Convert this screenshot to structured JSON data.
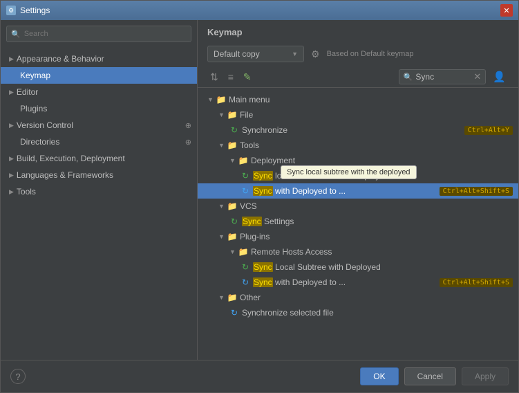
{
  "window": {
    "title": "Settings",
    "icon": "⚙"
  },
  "sidebar": {
    "search_placeholder": "Search",
    "items": [
      {
        "label": "Appearance & Behavior",
        "type": "parent",
        "expanded": true
      },
      {
        "label": "Keymap",
        "type": "child",
        "active": true
      },
      {
        "label": "Editor",
        "type": "parent",
        "expanded": true
      },
      {
        "label": "Plugins",
        "type": "child"
      },
      {
        "label": "Version Control",
        "type": "parent",
        "expanded": true
      },
      {
        "label": "Directories",
        "type": "child"
      },
      {
        "label": "Build, Execution, Deployment",
        "type": "parent"
      },
      {
        "label": "Languages & Frameworks",
        "type": "parent"
      },
      {
        "label": "Tools",
        "type": "parent"
      }
    ]
  },
  "keymap": {
    "title": "Keymap",
    "dropdown_value": "Default copy",
    "based_on": "Based on Default keymap",
    "search_placeholder": "Sync",
    "search_value": "Sync",
    "toolbar": {
      "btn1": "⇅",
      "btn2": "≡",
      "btn3": "✎"
    },
    "tree": [
      {
        "id": "main-menu",
        "level": 0,
        "type": "folder",
        "expanded": true,
        "label": "Main menu",
        "color": "blue"
      },
      {
        "id": "file",
        "level": 1,
        "type": "folder",
        "expanded": true,
        "label": "File",
        "color": "yellow"
      },
      {
        "id": "synchronize",
        "level": 2,
        "type": "action",
        "label": "Synchronize",
        "shortcut": "Ctrl+Alt+Y",
        "highlight": false,
        "sync_highlight": false
      },
      {
        "id": "tools",
        "level": 1,
        "type": "folder",
        "expanded": true,
        "label": "Tools",
        "color": "blue"
      },
      {
        "id": "deployment",
        "level": 2,
        "type": "folder",
        "expanded": true,
        "label": "Deployment",
        "color": "yellow"
      },
      {
        "id": "sync-local",
        "level": 3,
        "type": "action",
        "label": "Sync local subtree with the deployed",
        "tooltip": "Sync local subtree with the deployed",
        "has_tooltip": true
      },
      {
        "id": "sync-deployed",
        "level": 3,
        "type": "action",
        "label": "Sync with Deployed to ...",
        "shortcut": "Ctrl+Alt+Shift+S",
        "selected": true,
        "sync_prefix": "Sync"
      },
      {
        "id": "vcs",
        "level": 1,
        "type": "folder",
        "expanded": true,
        "label": "VCS",
        "color": "blue"
      },
      {
        "id": "sync-settings",
        "level": 2,
        "type": "action",
        "label": "Sync Settings",
        "sync_prefix": "Sync"
      },
      {
        "id": "plugins",
        "level": 1,
        "type": "folder",
        "expanded": true,
        "label": "Plug-ins",
        "color": "blue"
      },
      {
        "id": "remote-hosts",
        "level": 2,
        "type": "folder",
        "expanded": true,
        "label": "Remote Hosts Access",
        "color": "yellow"
      },
      {
        "id": "sync-local-2",
        "level": 3,
        "type": "action",
        "label": "Sync Local Subtree with Deployed",
        "sync_prefix": "Sync"
      },
      {
        "id": "sync-deployed-2",
        "level": 3,
        "type": "action",
        "label": "Sync with Deployed to ...",
        "shortcut": "Ctrl+Alt+Shift+S",
        "sync_prefix": "Sync"
      },
      {
        "id": "other",
        "level": 1,
        "type": "folder",
        "expanded": true,
        "label": "Other",
        "color": "yellow"
      },
      {
        "id": "sync-selected",
        "level": 2,
        "type": "action",
        "label": "Synchronize selected file"
      }
    ]
  },
  "footer": {
    "ok_label": "OK",
    "cancel_label": "Cancel",
    "apply_label": "Apply"
  }
}
